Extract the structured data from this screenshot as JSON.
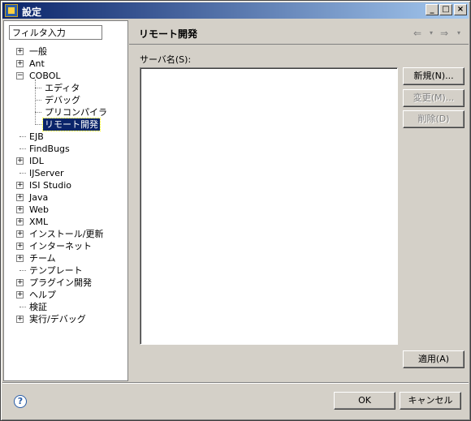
{
  "window": {
    "title": "設定",
    "min": "_",
    "max": "□",
    "close": "×"
  },
  "filter": {
    "placeholder": "フィルタ入力",
    "value": "フィルタ入力"
  },
  "tree": [
    {
      "label": "一般",
      "level": 0,
      "expander": "+"
    },
    {
      "label": "Ant",
      "level": 0,
      "expander": "+"
    },
    {
      "label": "COBOL",
      "level": 0,
      "expander": "−"
    },
    {
      "label": "エディタ",
      "level": 1
    },
    {
      "label": "デバッグ",
      "level": 1
    },
    {
      "label": "プリコンパイラ",
      "level": 1
    },
    {
      "label": "リモート開発",
      "level": 1,
      "selected": true
    },
    {
      "label": "EJB",
      "level": 0
    },
    {
      "label": "FindBugs",
      "level": 0
    },
    {
      "label": "IDL",
      "level": 0,
      "expander": "+"
    },
    {
      "label": "IJServer",
      "level": 0
    },
    {
      "label": "ISI Studio",
      "level": 0,
      "expander": "+"
    },
    {
      "label": "Java",
      "level": 0,
      "expander": "+"
    },
    {
      "label": "Web",
      "level": 0,
      "expander": "+"
    },
    {
      "label": "XML",
      "level": 0,
      "expander": "+"
    },
    {
      "label": "インストール/更新",
      "level": 0,
      "expander": "+"
    },
    {
      "label": "インターネット",
      "level": 0,
      "expander": "+"
    },
    {
      "label": "チーム",
      "level": 0,
      "expander": "+"
    },
    {
      "label": "テンプレート",
      "level": 0
    },
    {
      "label": "プラグイン開発",
      "level": 0,
      "expander": "+"
    },
    {
      "label": "ヘルプ",
      "level": 0,
      "expander": "+"
    },
    {
      "label": "検証",
      "level": 0
    },
    {
      "label": "実行/デバッグ",
      "level": 0,
      "expander": "+"
    }
  ],
  "page": {
    "title": "リモート開発",
    "back_icon": "⇐",
    "forward_icon": "⇒",
    "caret": "▾",
    "server_label": "サーバ名(S):"
  },
  "buttons": {
    "new": "新規(N)...",
    "change": "変更(M)...",
    "delete": "削除(D)",
    "apply": "適用(A)",
    "ok": "OK",
    "cancel": "キャンセル"
  },
  "help": {
    "glyph": "?"
  }
}
